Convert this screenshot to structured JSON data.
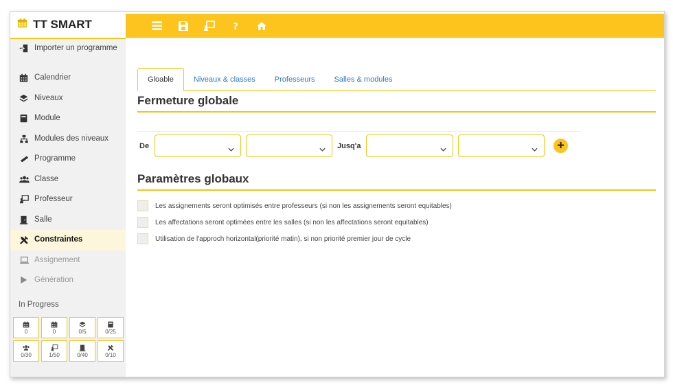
{
  "app": {
    "title": "TT SMART"
  },
  "topbar": {
    "icons": [
      "menu-icon",
      "save-icon",
      "screen-share-icon",
      "help-icon",
      "home-icon"
    ]
  },
  "sidebar": {
    "items": [
      {
        "label": "Importer un programme",
        "icon": "import-icon",
        "state": "normal"
      },
      {
        "label": "Calendrier",
        "icon": "calendar-icon",
        "state": "normal"
      },
      {
        "label": "Niveaux",
        "icon": "layers-icon",
        "state": "normal"
      },
      {
        "label": "Module",
        "icon": "book-icon",
        "state": "normal"
      },
      {
        "label": "Modules des niveaux",
        "icon": "sitemap-icon",
        "state": "normal"
      },
      {
        "label": "Programme",
        "icon": "ruler-icon",
        "state": "normal"
      },
      {
        "label": "Classe",
        "icon": "users-icon",
        "state": "normal"
      },
      {
        "label": "Professeur",
        "icon": "teacher-icon",
        "state": "normal"
      },
      {
        "label": "Salle",
        "icon": "door-icon",
        "state": "normal"
      },
      {
        "label": "Constraintes",
        "icon": "tools-icon",
        "state": "active"
      },
      {
        "label": "Assignement",
        "icon": "laptop-icon",
        "state": "disabled"
      },
      {
        "label": "Génération",
        "icon": "play-icon",
        "state": "disabled"
      }
    ],
    "progress_title": "In Progress",
    "progress": [
      {
        "icon": "calendar-icon",
        "value": "0"
      },
      {
        "icon": "calendar-icon",
        "value": "0"
      },
      {
        "icon": "layers-icon",
        "value": "0/5"
      },
      {
        "icon": "book-icon",
        "value": "0/25"
      },
      {
        "icon": "users-icon",
        "value": "0/30"
      },
      {
        "icon": "teacher-icon",
        "value": "1/50"
      },
      {
        "icon": "door-icon",
        "value": "0/40"
      },
      {
        "icon": "tools-icon",
        "value": "0/10"
      }
    ]
  },
  "tabs": [
    {
      "label": "Gloable",
      "active": true
    },
    {
      "label": "Niveaux & classes",
      "active": false
    },
    {
      "label": "Professeurs",
      "active": false
    },
    {
      "label": "Salles & modules",
      "active": false
    }
  ],
  "fermeture": {
    "title": "Fermeture globale",
    "from_label": "De",
    "to_label": "Jusq'a",
    "from_day": "",
    "from_slot": "",
    "to_day": "",
    "to_slot": ""
  },
  "parametres": {
    "title": "Paramètres globaux",
    "options": [
      {
        "label": "Les assignements seront optimisés entre professeurs (si non les assignements seront equitables)",
        "checked": false
      },
      {
        "label": "Les affectations seront optimées entre les salles (si non les affectations seront equitables)",
        "checked": false
      },
      {
        "label": "Utilisation de l'approch horizontal(priorité matin), si non priorité premier jour de cycle",
        "checked": false
      }
    ]
  },
  "colors": {
    "accent": "#fcc41c",
    "link": "#2a7ac0",
    "active_bg": "#fdf6dc"
  }
}
